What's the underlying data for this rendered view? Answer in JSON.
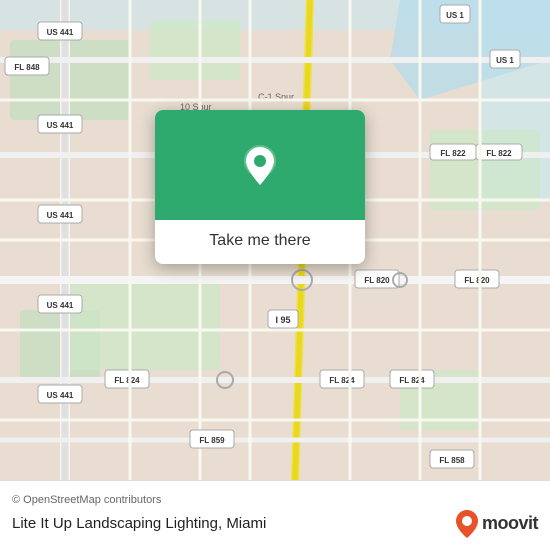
{
  "map": {
    "attribution": "© OpenStreetMap contributors",
    "location_name": "Lite It Up Landscaping Lighting, Miami"
  },
  "popup": {
    "button_label": "Take me there"
  },
  "moovit": {
    "logo_text": "moovit"
  },
  "colors": {
    "map_green": "#2eaa6e",
    "road_yellow": "#f5e56b",
    "road_white": "#ffffff",
    "water_blue": "#b3d9e8",
    "park_green": "#c8e6c9",
    "bg_tan": "#e8e0d8"
  }
}
